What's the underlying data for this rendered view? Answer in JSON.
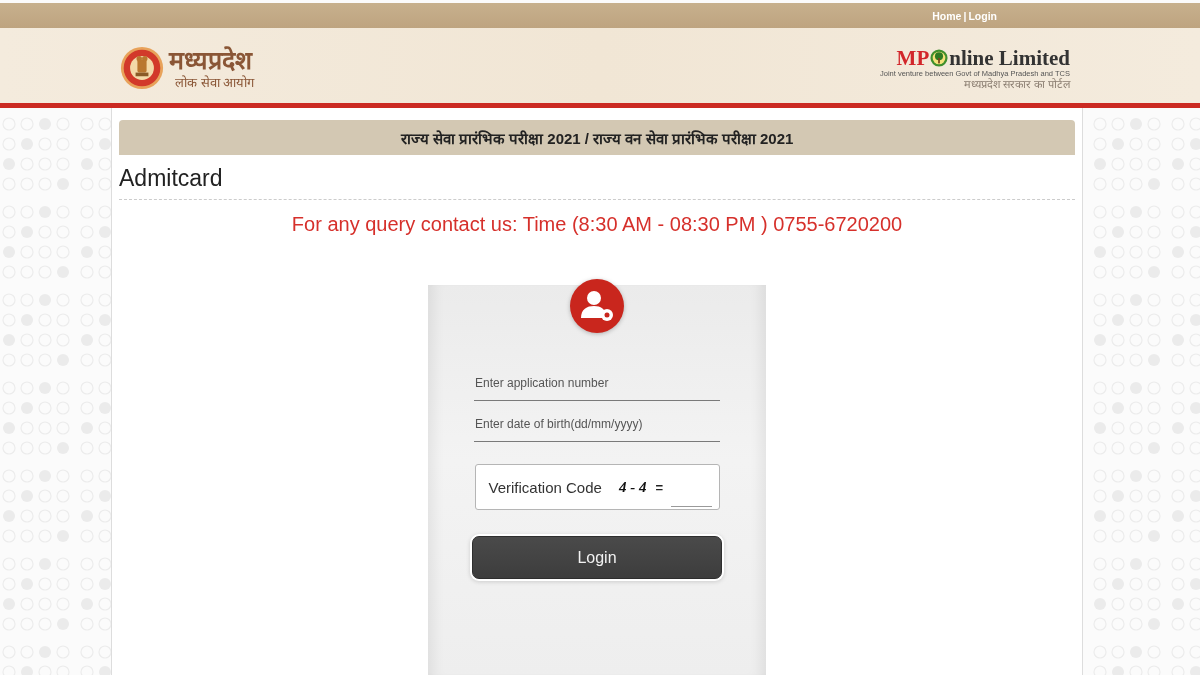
{
  "top_bar": {
    "links": [
      {
        "label": "Home"
      },
      {
        "label": "Login"
      }
    ],
    "separator": "|"
  },
  "header": {
    "logo_left": {
      "title": "मध्यप्रदेश",
      "subtitle": "लोक सेवा आयोग"
    },
    "logo_right": {
      "brand_prefix": "MP",
      "brand_rest": "nline Limited",
      "tagline": "Joint venture between Govt of Madhya Pradesh and TCS",
      "subtitle": "मध्यप्रदेश सरकार का पोर्टल"
    }
  },
  "banner": {
    "title": "राज्य सेवा प्रारंभिक परीक्षा 2021 / राज्य वन सेवा प्रारंभिक परीक्षा 2021"
  },
  "page_title": "Admitcard",
  "notice": "For any query contact us: Time (8:30 AM - 08:30 PM ) 0755-6720200",
  "login_form": {
    "fields": [
      {
        "placeholder": "Enter application number"
      },
      {
        "placeholder": "Enter date of birth(dd/mm/yyyy)"
      }
    ],
    "captcha": {
      "label": "Verification Code",
      "question": "4 - 4",
      "equals": "="
    },
    "submit": "Login"
  }
}
